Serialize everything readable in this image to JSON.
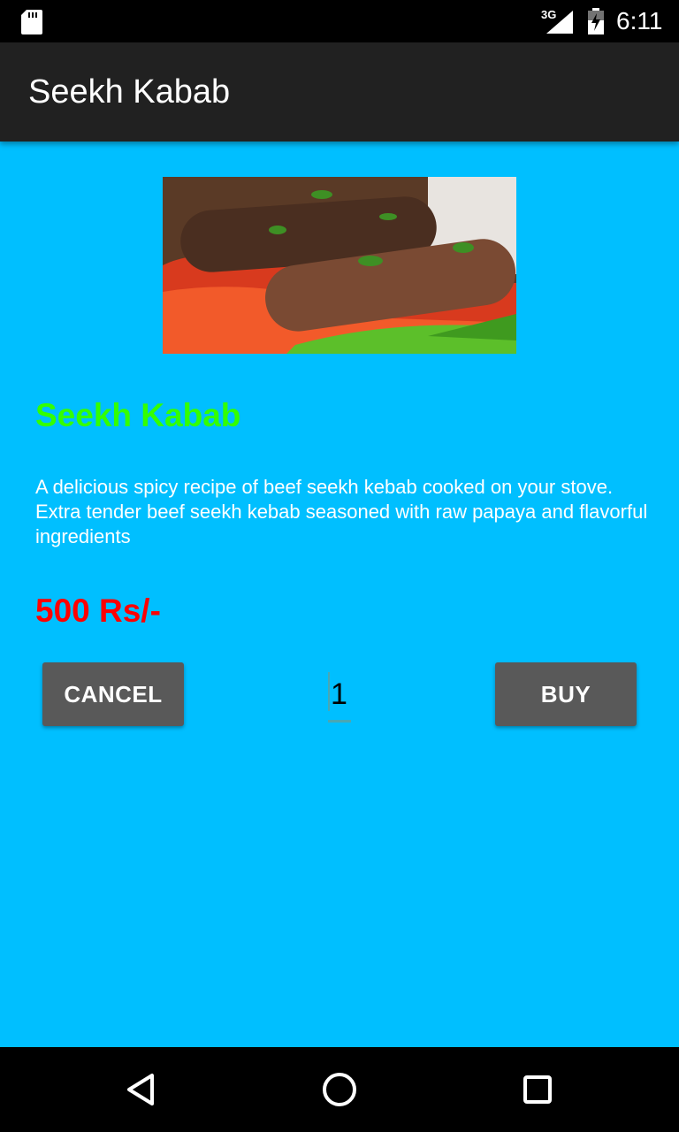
{
  "status_bar": {
    "network": "3G",
    "time": "6:11",
    "icons": [
      "sd-card-icon",
      "signal-icon",
      "battery-icon"
    ]
  },
  "toolbar": {
    "title": "Seekh Kabab"
  },
  "product": {
    "image": "seekh-kabab-photo",
    "name": "Seekh Kabab",
    "description": "A delicious spicy recipe of beef seekh kebab cooked on your stove. Extra tender beef seekh kebab seasoned with raw papaya and flavorful ingredients",
    "price": "500 Rs/-"
  },
  "actions": {
    "cancel_label": "CANCEL",
    "quantity": "1",
    "buy_label": "BUY"
  },
  "nav": {
    "icons": [
      "back-icon",
      "home-icon",
      "recents-icon"
    ]
  },
  "colors": {
    "background": "#00BFFF",
    "toolbar": "#212121",
    "name": "#33FF00",
    "price": "#FF0000",
    "button": "#595959"
  }
}
